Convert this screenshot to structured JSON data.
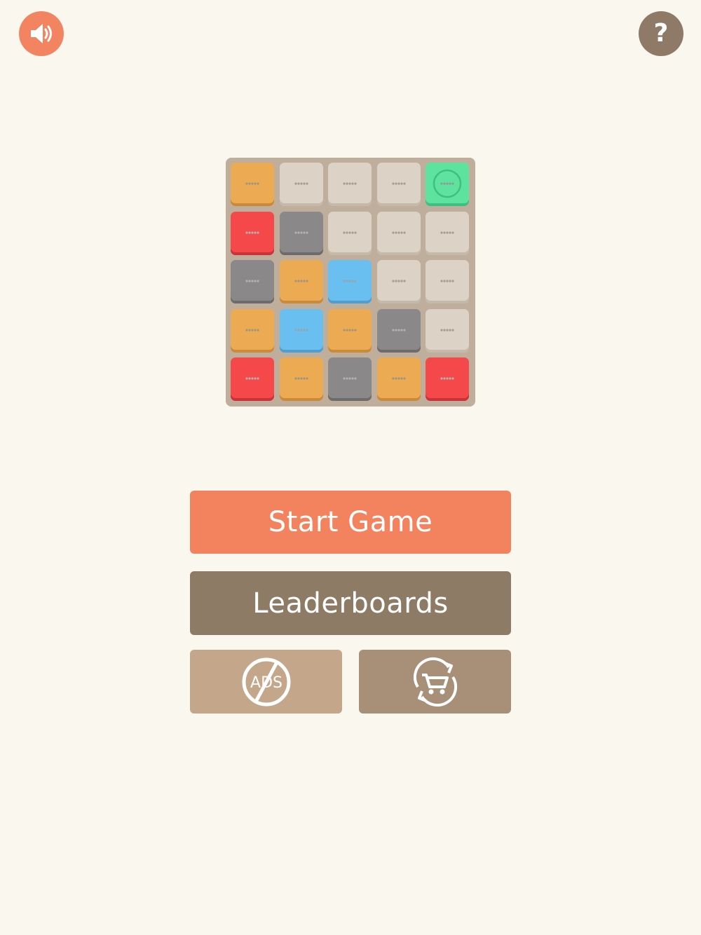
{
  "top_bar": {
    "sound_icon": "speaker-volume-icon",
    "help_label": "?"
  },
  "board": {
    "rows": 5,
    "cols": 5,
    "tiles": [
      [
        "orange",
        "empty",
        "empty",
        "empty",
        "green"
      ],
      [
        "red",
        "gray",
        "empty",
        "empty",
        "empty"
      ],
      [
        "gray",
        "orange",
        "blue",
        "empty",
        "empty"
      ],
      [
        "orange",
        "blue",
        "orange",
        "gray",
        "empty"
      ],
      [
        "red",
        "orange",
        "gray",
        "orange",
        "red"
      ]
    ],
    "colors": {
      "orange": "#ecab52",
      "red": "#f4484b",
      "gray": "#8a8888",
      "blue": "#69bff0",
      "green": "#5ee39e",
      "empty": "#dcd2c6",
      "board_bg": "#bfae9c"
    }
  },
  "menu": {
    "start_label": "Start Game",
    "leaderboards_label": "Leaderboards",
    "no_ads_text": "ADS",
    "no_ads_icon": "no-ads-icon",
    "restore_icon": "cart-restore-icon"
  },
  "colors": {
    "background": "#faf7ee",
    "accent": "#f3835f",
    "brown": "#8d7b66"
  }
}
